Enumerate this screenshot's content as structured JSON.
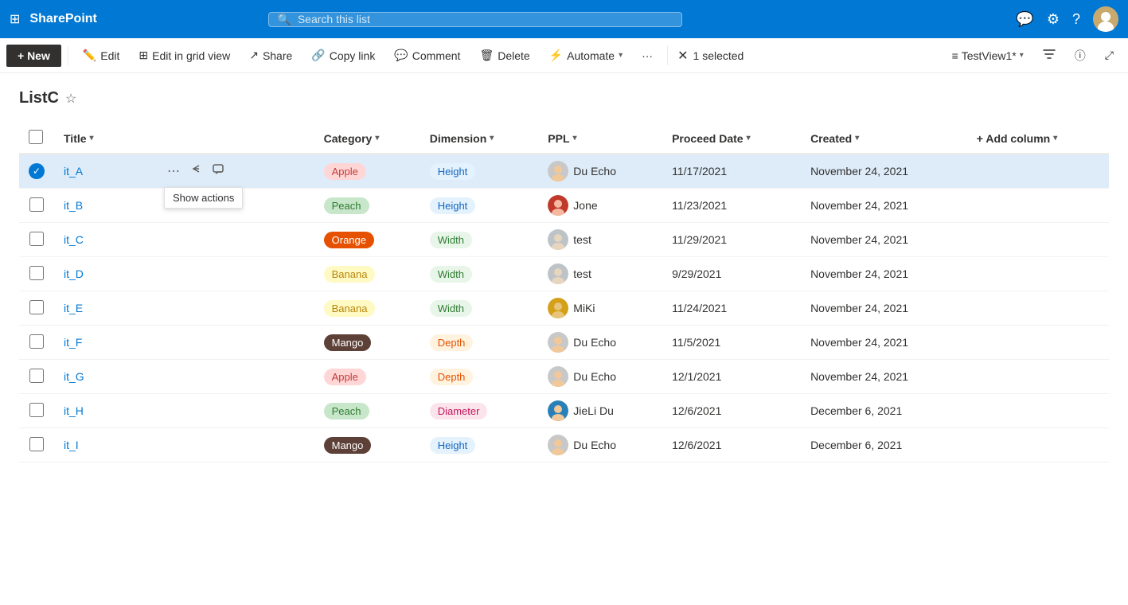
{
  "topbar": {
    "app_name": "SharePoint",
    "search_placeholder": "Search this list"
  },
  "commandbar": {
    "new_label": "+ New",
    "edit_label": "Edit",
    "edit_grid_label": "Edit in grid view",
    "share_label": "Share",
    "copy_link_label": "Copy link",
    "comment_label": "Comment",
    "delete_label": "Delete",
    "automate_label": "Automate",
    "more_label": "···",
    "selected_label": "1 selected",
    "view_label": "TestView1*",
    "filter_icon": "filter",
    "info_icon": "info",
    "collapse_icon": "collapse"
  },
  "page": {
    "list_title": "ListC",
    "star_label": "favorite"
  },
  "table": {
    "columns": [
      {
        "key": "select",
        "label": ""
      },
      {
        "key": "title",
        "label": "Title"
      },
      {
        "key": "category",
        "label": "Category"
      },
      {
        "key": "dimension",
        "label": "Dimension"
      },
      {
        "key": "ppl",
        "label": "PPL"
      },
      {
        "key": "proceed_date",
        "label": "Proceed Date"
      },
      {
        "key": "created",
        "label": "Created"
      },
      {
        "key": "add_column",
        "label": "+ Add column"
      }
    ],
    "rows": [
      {
        "id": "it_A",
        "title": "it_A",
        "category": "Apple",
        "category_class": "badge-apple",
        "dimension": "Height",
        "dimension_class": "badge-height",
        "ppl": "Du Echo",
        "ppl_avatar": "du",
        "proceed_date": "11/17/2021",
        "created": "November 24, 2021",
        "selected": true
      },
      {
        "id": "it_B",
        "title": "it_B",
        "category": "Peach",
        "category_class": "badge-peach",
        "dimension": "Height",
        "dimension_class": "badge-height",
        "ppl": "Jone",
        "ppl_avatar": "jone",
        "proceed_date": "11/23/2021",
        "created": "November 24, 2021",
        "selected": false
      },
      {
        "id": "it_C",
        "title": "it_C",
        "category": "Orange",
        "category_class": "badge-orange",
        "dimension": "Width",
        "dimension_class": "badge-width",
        "ppl": "test",
        "ppl_avatar": "test",
        "proceed_date": "11/29/2021",
        "created": "November 24, 2021",
        "selected": false
      },
      {
        "id": "it_D",
        "title": "it_D",
        "category": "Banana",
        "category_class": "badge-banana",
        "dimension": "Width",
        "dimension_class": "badge-width",
        "ppl": "test",
        "ppl_avatar": "test",
        "proceed_date": "9/29/2021",
        "created": "November 24, 2021",
        "selected": false
      },
      {
        "id": "it_E",
        "title": "it_E",
        "category": "Banana",
        "category_class": "badge-banana",
        "dimension": "Width",
        "dimension_class": "badge-width",
        "ppl": "MiKi",
        "ppl_avatar": "miki",
        "proceed_date": "11/24/2021",
        "created": "November 24, 2021",
        "selected": false
      },
      {
        "id": "it_F",
        "title": "it_F",
        "category": "Mango",
        "category_class": "badge-mango",
        "dimension": "Depth",
        "dimension_class": "badge-depth",
        "ppl": "Du Echo",
        "ppl_avatar": "du",
        "proceed_date": "11/5/2021",
        "created": "November 24, 2021",
        "selected": false
      },
      {
        "id": "it_G",
        "title": "it_G",
        "category": "Apple",
        "category_class": "badge-apple",
        "dimension": "Depth",
        "dimension_class": "badge-depth",
        "ppl": "Du Echo",
        "ppl_avatar": "du",
        "proceed_date": "12/1/2021",
        "created": "November 24, 2021",
        "selected": false
      },
      {
        "id": "it_H",
        "title": "it_H",
        "category": "Peach",
        "category_class": "badge-peach",
        "dimension": "Diameter",
        "dimension_class": "badge-diameter",
        "ppl": "JieLi Du",
        "ppl_avatar": "jieli",
        "proceed_date": "12/6/2021",
        "created": "December 6, 2021",
        "selected": false
      },
      {
        "id": "it_I",
        "title": "it_I",
        "category": "Mango",
        "category_class": "badge-mango",
        "dimension": "Height",
        "dimension_class": "badge-height",
        "ppl": "Du Echo",
        "ppl_avatar": "du",
        "proceed_date": "12/6/2021",
        "created": "December 6, 2021",
        "selected": false
      }
    ],
    "show_actions_tooltip": "Show actions"
  }
}
